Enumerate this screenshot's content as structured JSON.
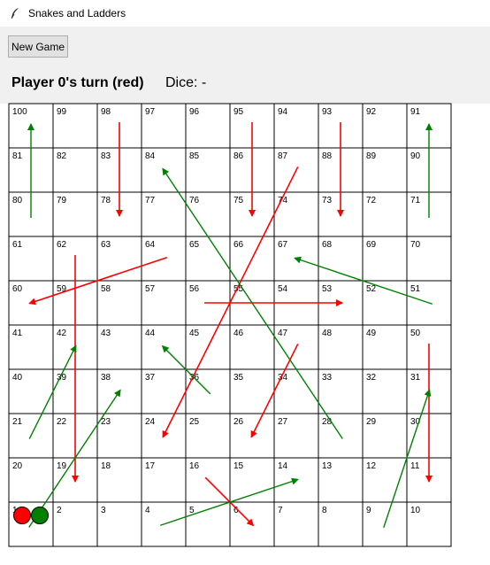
{
  "window": {
    "title": "Snakes and Ladders",
    "icon": "feather-icon"
  },
  "toolbar": {
    "new_game_label": "New Game"
  },
  "status": {
    "turn_text": "Player 0's turn (red)",
    "dice_text": "Dice: -"
  },
  "board": {
    "rows": [
      [
        100,
        99,
        98,
        97,
        96,
        95,
        94,
        93,
        92,
        91
      ],
      [
        81,
        82,
        83,
        84,
        85,
        86,
        87,
        88,
        89,
        90
      ],
      [
        80,
        79,
        78,
        77,
        76,
        75,
        74,
        73,
        72,
        71
      ],
      [
        61,
        62,
        63,
        64,
        65,
        66,
        67,
        68,
        69,
        70
      ],
      [
        60,
        59,
        58,
        57,
        56,
        55,
        54,
        53,
        52,
        51
      ],
      [
        41,
        42,
        43,
        44,
        45,
        46,
        47,
        48,
        49,
        50
      ],
      [
        40,
        39,
        38,
        37,
        36,
        35,
        34,
        33,
        32,
        31
      ],
      [
        21,
        22,
        23,
        24,
        25,
        26,
        27,
        28,
        29,
        30
      ],
      [
        20,
        19,
        18,
        17,
        16,
        15,
        14,
        13,
        12,
        11
      ],
      [
        1,
        2,
        3,
        4,
        5,
        6,
        7,
        8,
        9,
        10
      ]
    ],
    "snake_color": "#ff0000",
    "ladder_color": "#008000",
    "snakes": [
      {
        "from": 98,
        "to": 78
      },
      {
        "from": 95,
        "to": 75
      },
      {
        "from": 93,
        "to": 73
      },
      {
        "from": 87,
        "to": 24
      },
      {
        "from": 64,
        "to": 60
      },
      {
        "from": 62,
        "to": 19
      },
      {
        "from": 56,
        "to": 53
      },
      {
        "from": 50,
        "to": 11
      },
      {
        "from": 47,
        "to": 26
      },
      {
        "from": 16,
        "to": 6
      }
    ],
    "ladders": [
      {
        "from": 80,
        "to": 100
      },
      {
        "from": 71,
        "to": 91
      },
      {
        "from": 51,
        "to": 67
      },
      {
        "from": 28,
        "to": 84
      },
      {
        "from": 36,
        "to": 44
      },
      {
        "from": 21,
        "to": 42
      },
      {
        "from": 1,
        "to": 38
      },
      {
        "from": 9,
        "to": 31
      },
      {
        "from": 4,
        "to": 14
      }
    ]
  },
  "players": [
    {
      "name": "Player 0",
      "color": "#ff0000",
      "position": 1
    },
    {
      "name": "Player 1",
      "color": "#008000",
      "position": 1
    }
  ]
}
